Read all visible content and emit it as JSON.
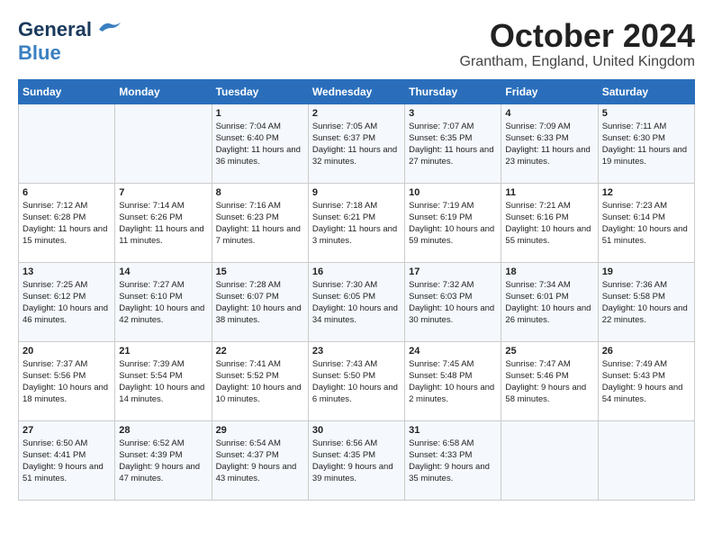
{
  "logo": {
    "line1": "General",
    "line2": "Blue"
  },
  "header": {
    "month": "October 2024",
    "location": "Grantham, England, United Kingdom"
  },
  "weekdays": [
    "Sunday",
    "Monday",
    "Tuesday",
    "Wednesday",
    "Thursday",
    "Friday",
    "Saturday"
  ],
  "weeks": [
    [
      {
        "day": "",
        "sunrise": "",
        "sunset": "",
        "daylight": ""
      },
      {
        "day": "",
        "sunrise": "",
        "sunset": "",
        "daylight": ""
      },
      {
        "day": "1",
        "sunrise": "Sunrise: 7:04 AM",
        "sunset": "Sunset: 6:40 PM",
        "daylight": "Daylight: 11 hours and 36 minutes."
      },
      {
        "day": "2",
        "sunrise": "Sunrise: 7:05 AM",
        "sunset": "Sunset: 6:37 PM",
        "daylight": "Daylight: 11 hours and 32 minutes."
      },
      {
        "day": "3",
        "sunrise": "Sunrise: 7:07 AM",
        "sunset": "Sunset: 6:35 PM",
        "daylight": "Daylight: 11 hours and 27 minutes."
      },
      {
        "day": "4",
        "sunrise": "Sunrise: 7:09 AM",
        "sunset": "Sunset: 6:33 PM",
        "daylight": "Daylight: 11 hours and 23 minutes."
      },
      {
        "day": "5",
        "sunrise": "Sunrise: 7:11 AM",
        "sunset": "Sunset: 6:30 PM",
        "daylight": "Daylight: 11 hours and 19 minutes."
      }
    ],
    [
      {
        "day": "6",
        "sunrise": "Sunrise: 7:12 AM",
        "sunset": "Sunset: 6:28 PM",
        "daylight": "Daylight: 11 hours and 15 minutes."
      },
      {
        "day": "7",
        "sunrise": "Sunrise: 7:14 AM",
        "sunset": "Sunset: 6:26 PM",
        "daylight": "Daylight: 11 hours and 11 minutes."
      },
      {
        "day": "8",
        "sunrise": "Sunrise: 7:16 AM",
        "sunset": "Sunset: 6:23 PM",
        "daylight": "Daylight: 11 hours and 7 minutes."
      },
      {
        "day": "9",
        "sunrise": "Sunrise: 7:18 AM",
        "sunset": "Sunset: 6:21 PM",
        "daylight": "Daylight: 11 hours and 3 minutes."
      },
      {
        "day": "10",
        "sunrise": "Sunrise: 7:19 AM",
        "sunset": "Sunset: 6:19 PM",
        "daylight": "Daylight: 10 hours and 59 minutes."
      },
      {
        "day": "11",
        "sunrise": "Sunrise: 7:21 AM",
        "sunset": "Sunset: 6:16 PM",
        "daylight": "Daylight: 10 hours and 55 minutes."
      },
      {
        "day": "12",
        "sunrise": "Sunrise: 7:23 AM",
        "sunset": "Sunset: 6:14 PM",
        "daylight": "Daylight: 10 hours and 51 minutes."
      }
    ],
    [
      {
        "day": "13",
        "sunrise": "Sunrise: 7:25 AM",
        "sunset": "Sunset: 6:12 PM",
        "daylight": "Daylight: 10 hours and 46 minutes."
      },
      {
        "day": "14",
        "sunrise": "Sunrise: 7:27 AM",
        "sunset": "Sunset: 6:10 PM",
        "daylight": "Daylight: 10 hours and 42 minutes."
      },
      {
        "day": "15",
        "sunrise": "Sunrise: 7:28 AM",
        "sunset": "Sunset: 6:07 PM",
        "daylight": "Daylight: 10 hours and 38 minutes."
      },
      {
        "day": "16",
        "sunrise": "Sunrise: 7:30 AM",
        "sunset": "Sunset: 6:05 PM",
        "daylight": "Daylight: 10 hours and 34 minutes."
      },
      {
        "day": "17",
        "sunrise": "Sunrise: 7:32 AM",
        "sunset": "Sunset: 6:03 PM",
        "daylight": "Daylight: 10 hours and 30 minutes."
      },
      {
        "day": "18",
        "sunrise": "Sunrise: 7:34 AM",
        "sunset": "Sunset: 6:01 PM",
        "daylight": "Daylight: 10 hours and 26 minutes."
      },
      {
        "day": "19",
        "sunrise": "Sunrise: 7:36 AM",
        "sunset": "Sunset: 5:58 PM",
        "daylight": "Daylight: 10 hours and 22 minutes."
      }
    ],
    [
      {
        "day": "20",
        "sunrise": "Sunrise: 7:37 AM",
        "sunset": "Sunset: 5:56 PM",
        "daylight": "Daylight: 10 hours and 18 minutes."
      },
      {
        "day": "21",
        "sunrise": "Sunrise: 7:39 AM",
        "sunset": "Sunset: 5:54 PM",
        "daylight": "Daylight: 10 hours and 14 minutes."
      },
      {
        "day": "22",
        "sunrise": "Sunrise: 7:41 AM",
        "sunset": "Sunset: 5:52 PM",
        "daylight": "Daylight: 10 hours and 10 minutes."
      },
      {
        "day": "23",
        "sunrise": "Sunrise: 7:43 AM",
        "sunset": "Sunset: 5:50 PM",
        "daylight": "Daylight: 10 hours and 6 minutes."
      },
      {
        "day": "24",
        "sunrise": "Sunrise: 7:45 AM",
        "sunset": "Sunset: 5:48 PM",
        "daylight": "Daylight: 10 hours and 2 minutes."
      },
      {
        "day": "25",
        "sunrise": "Sunrise: 7:47 AM",
        "sunset": "Sunset: 5:46 PM",
        "daylight": "Daylight: 9 hours and 58 minutes."
      },
      {
        "day": "26",
        "sunrise": "Sunrise: 7:49 AM",
        "sunset": "Sunset: 5:43 PM",
        "daylight": "Daylight: 9 hours and 54 minutes."
      }
    ],
    [
      {
        "day": "27",
        "sunrise": "Sunrise: 6:50 AM",
        "sunset": "Sunset: 4:41 PM",
        "daylight": "Daylight: 9 hours and 51 minutes."
      },
      {
        "day": "28",
        "sunrise": "Sunrise: 6:52 AM",
        "sunset": "Sunset: 4:39 PM",
        "daylight": "Daylight: 9 hours and 47 minutes."
      },
      {
        "day": "29",
        "sunrise": "Sunrise: 6:54 AM",
        "sunset": "Sunset: 4:37 PM",
        "daylight": "Daylight: 9 hours and 43 minutes."
      },
      {
        "day": "30",
        "sunrise": "Sunrise: 6:56 AM",
        "sunset": "Sunset: 4:35 PM",
        "daylight": "Daylight: 9 hours and 39 minutes."
      },
      {
        "day": "31",
        "sunrise": "Sunrise: 6:58 AM",
        "sunset": "Sunset: 4:33 PM",
        "daylight": "Daylight: 9 hours and 35 minutes."
      },
      {
        "day": "",
        "sunrise": "",
        "sunset": "",
        "daylight": ""
      },
      {
        "day": "",
        "sunrise": "",
        "sunset": "",
        "daylight": ""
      }
    ]
  ]
}
